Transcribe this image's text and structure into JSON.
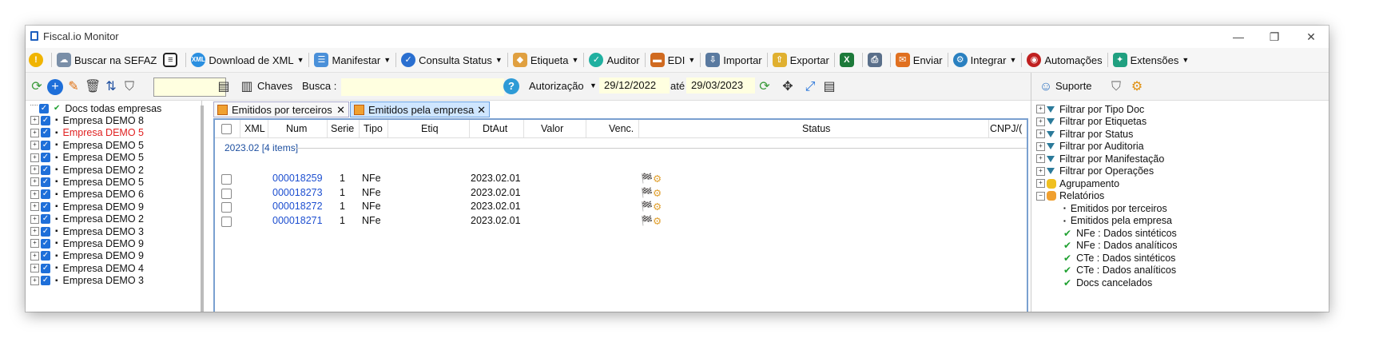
{
  "window": {
    "title": "Fiscal.io Monitor"
  },
  "menu": {
    "buscar": "Buscar na SEFAZ",
    "download": "Download de XML",
    "manifestar": "Manifestar",
    "consulta": "Consulta Status",
    "etiqueta": "Etiqueta",
    "auditor": "Auditor",
    "edi": "EDI",
    "importar": "Importar",
    "exportar": "Exportar",
    "enviar": "Enviar",
    "integrar": "Integrar",
    "automacoes": "Automações",
    "extensoes": "Extensões"
  },
  "toolbar": {
    "chaves": "Chaves",
    "busca_label": "Busca :",
    "autorizacao": "Autorização",
    "date_from": "29/12/2022",
    "ate": "até",
    "date_to": "29/03/2023"
  },
  "right_toolbar": {
    "suporte": "Suporte"
  },
  "left_tree": [
    {
      "label": "Docs todas empresas",
      "color": "#111111"
    },
    {
      "label": "Empresa DEMO 8",
      "color": "#111111"
    },
    {
      "label": "Empresa DEMO 5",
      "color": "#e02020"
    },
    {
      "label": "Empresa DEMO 5",
      "color": "#111111"
    },
    {
      "label": "Empresa DEMO 5",
      "color": "#111111"
    },
    {
      "label": "Empresa DEMO 2",
      "color": "#111111"
    },
    {
      "label": "Empresa DEMO 5",
      "color": "#111111"
    },
    {
      "label": "Empresa DEMO 6",
      "color": "#111111"
    },
    {
      "label": "Empresa DEMO 9",
      "color": "#111111"
    },
    {
      "label": "Empresa DEMO 2",
      "color": "#111111"
    },
    {
      "label": "Empresa DEMO 3",
      "color": "#111111"
    },
    {
      "label": "Empresa DEMO 9",
      "color": "#111111"
    },
    {
      "label": "Empresa DEMO 9",
      "color": "#111111"
    },
    {
      "label": "Empresa DEMO 4",
      "color": "#111111"
    },
    {
      "label": "Empresa DEMO 3",
      "color": "#111111"
    }
  ],
  "tabs": [
    {
      "label": "Emitidos por terceiros"
    },
    {
      "label": "Emitidos pela empresa"
    }
  ],
  "grid": {
    "columns": [
      "XML",
      "Num",
      "Serie",
      "Tipo",
      "Etiq",
      "DtAut",
      "Valor",
      "Venc.",
      "Status",
      "CNPJ/("
    ],
    "group": "2023.02 [4 items]",
    "rows": [
      {
        "num": "000018259",
        "serie": "1",
        "tipo": "NFe",
        "dtaut": "2023.02.01"
      },
      {
        "num": "000018273",
        "serie": "1",
        "tipo": "NFe",
        "dtaut": "2023.02.01"
      },
      {
        "num": "000018272",
        "serie": "1",
        "tipo": "NFe",
        "dtaut": "2023.02.01"
      },
      {
        "num": "000018271",
        "serie": "1",
        "tipo": "NFe",
        "dtaut": "2023.02.01"
      }
    ]
  },
  "right_tree": {
    "filters": [
      "Filtrar por Tipo Doc",
      "Filtrar por Etiquetas",
      "Filtrar por Status",
      "Filtrar por Auditoria",
      "Filtrar por Manifestação",
      "Filtrar por Operações",
      "Agrupamento",
      "Relatórios"
    ],
    "reports": [
      "Emitidos por terceiros",
      "Emitidos pela empresa",
      "NFe : Dados sintéticos",
      "NFe : Dados analíticos",
      "CTe : Dados sintéticos",
      "CTe : Dados analíticos",
      "Docs cancelados"
    ]
  }
}
